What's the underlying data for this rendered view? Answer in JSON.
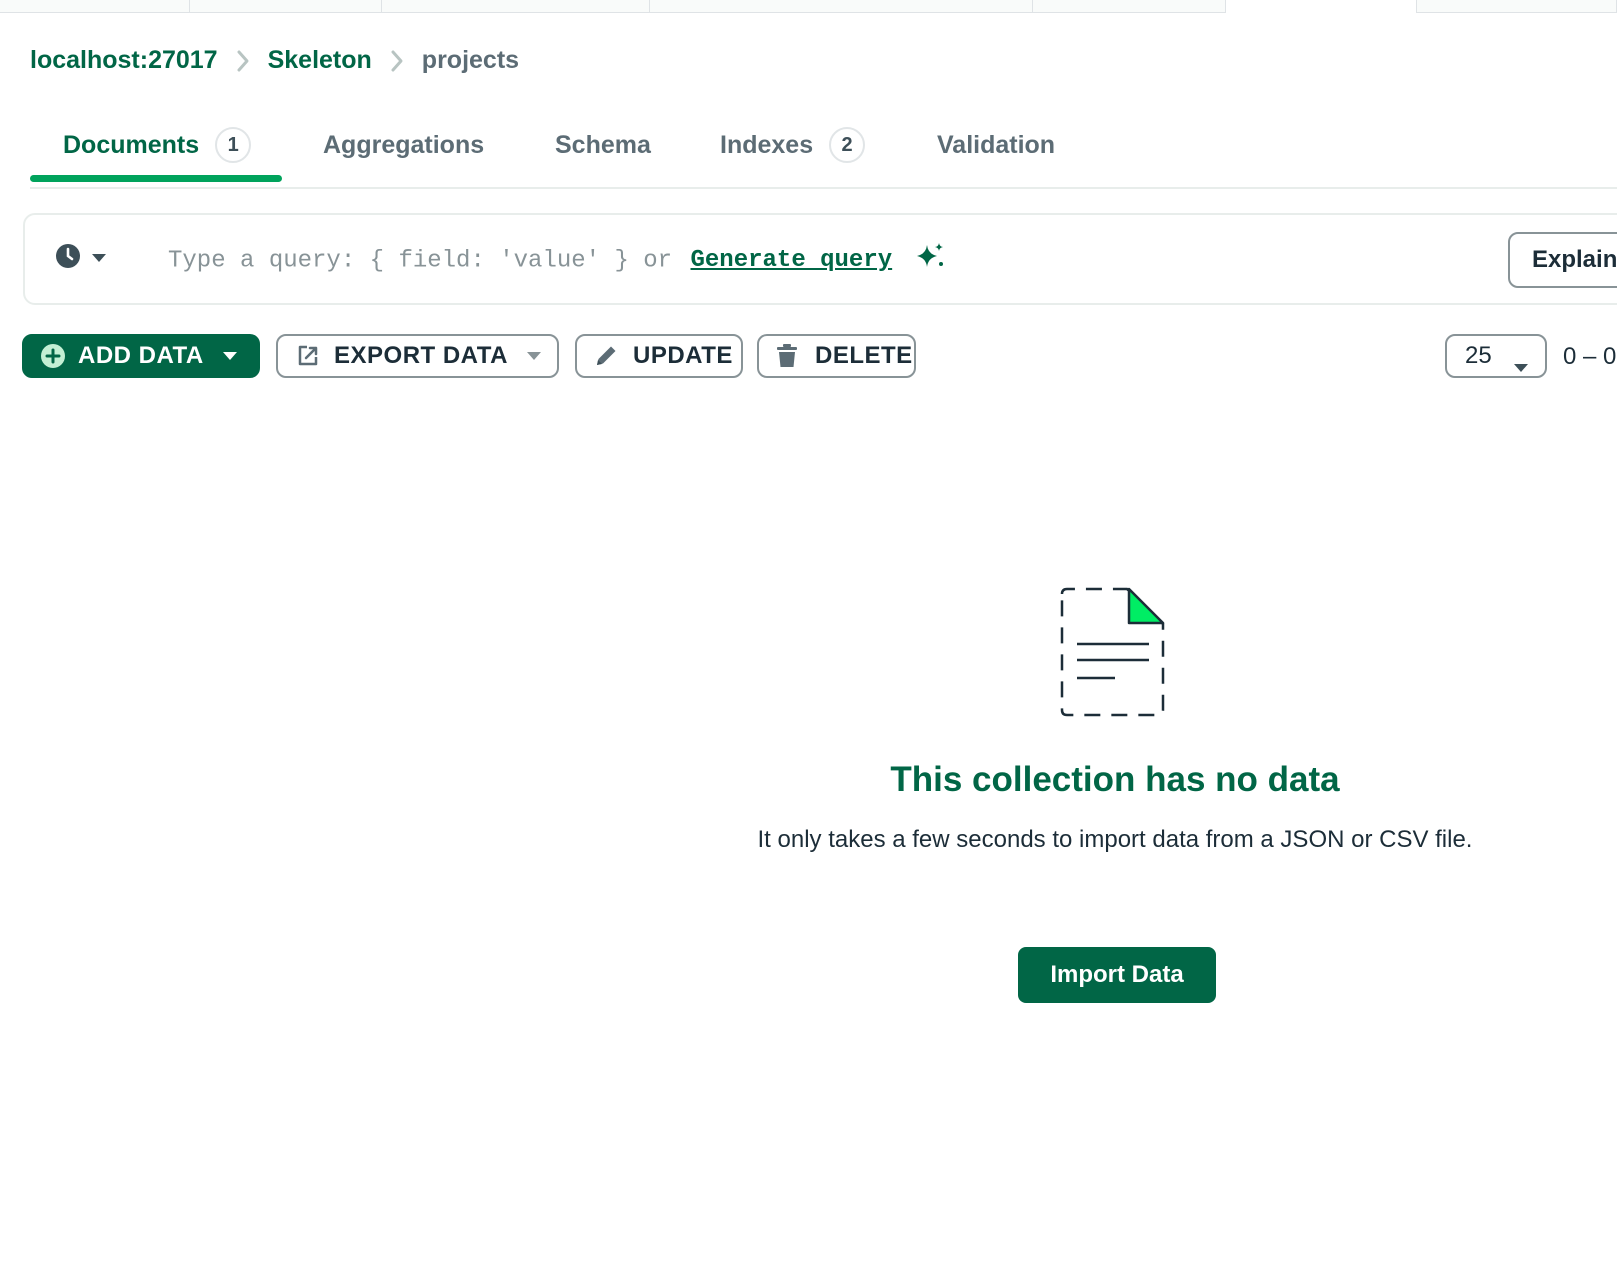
{
  "breadcrumb": {
    "host": "localhost:27017",
    "database": "Skeleton",
    "collection": "projects"
  },
  "tabs": [
    {
      "label": "Documents",
      "badge": "1",
      "active": true
    },
    {
      "label": "Aggregations"
    },
    {
      "label": "Schema"
    },
    {
      "label": "Indexes",
      "badge": "2"
    },
    {
      "label": "Validation"
    }
  ],
  "query": {
    "placeholder": "Type a query: { field: 'value' } or",
    "generate_label": "Generate query",
    "explain_label": "Explain"
  },
  "toolbar": {
    "add_data": "ADD DATA",
    "export_data": "EXPORT DATA",
    "update": "UPDATE",
    "delete": "DELETE",
    "per_page": "25",
    "range": "0 – 0"
  },
  "empty_state": {
    "title": "This collection has no data",
    "description": "It only takes a few seconds to import data from a JSON or CSV file.",
    "import_button": "Import Data"
  },
  "colors": {
    "brand_green": "#016646",
    "accent_green": "#00a35c",
    "muted_text": "#5c6c75"
  },
  "icons": [
    "chevron-right-icon",
    "clock-icon",
    "caret-down-icon",
    "sparkle-icon",
    "plus-circle-icon",
    "export-icon",
    "pencil-icon",
    "trash-icon",
    "empty-document-icon"
  ]
}
